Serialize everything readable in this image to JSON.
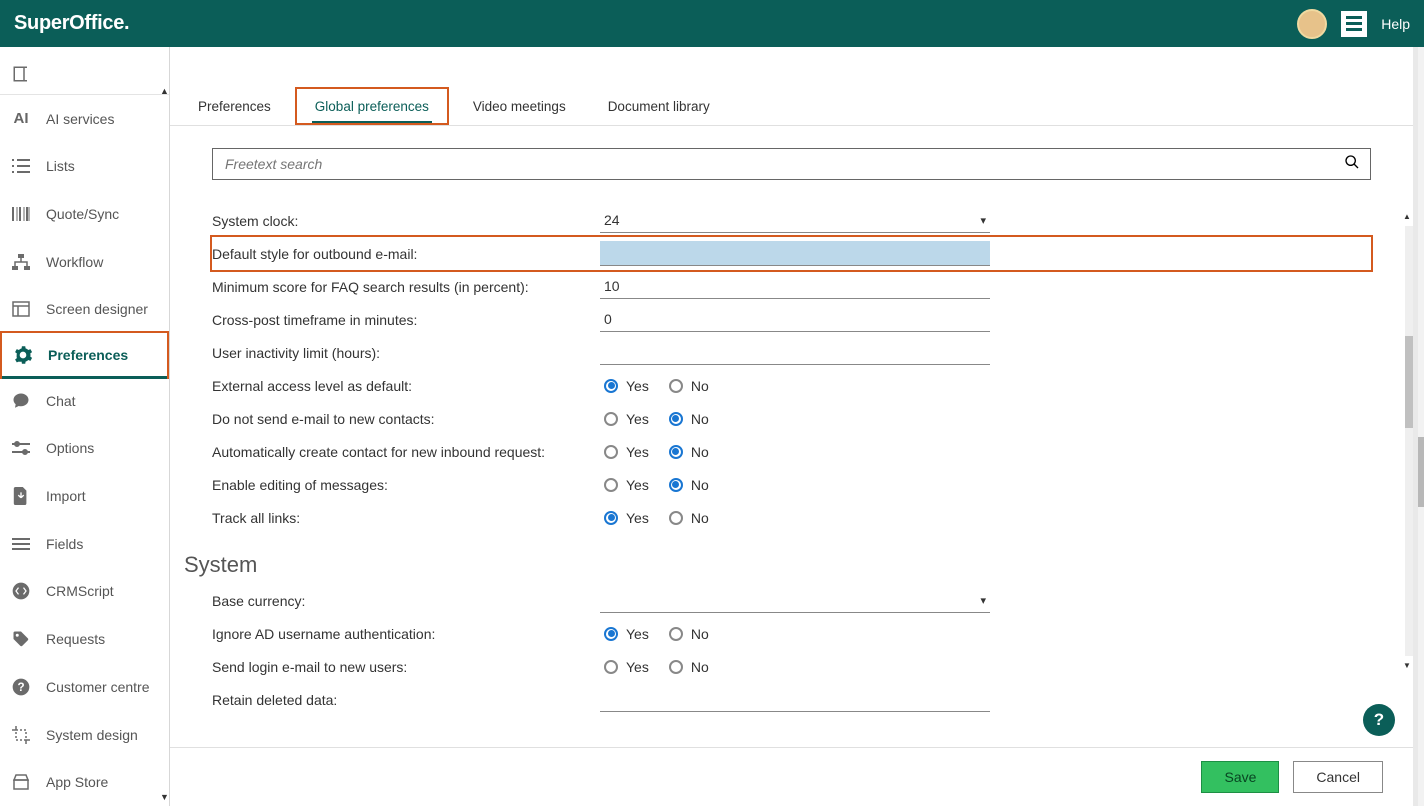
{
  "header": {
    "brand": "SuperOffice.",
    "help_label": "Help"
  },
  "sidebar": {
    "items": [
      {
        "label": ""
      },
      {
        "label": "AI services"
      },
      {
        "label": "Lists"
      },
      {
        "label": "Quote/Sync"
      },
      {
        "label": "Workflow"
      },
      {
        "label": "Screen designer"
      },
      {
        "label": "Preferences"
      },
      {
        "label": "Chat"
      },
      {
        "label": "Options"
      },
      {
        "label": "Import"
      },
      {
        "label": "Fields"
      },
      {
        "label": "CRMScript"
      },
      {
        "label": "Requests"
      },
      {
        "label": "Customer centre"
      },
      {
        "label": "System design"
      },
      {
        "label": "App Store"
      }
    ]
  },
  "tabs": {
    "items": [
      {
        "label": "Preferences"
      },
      {
        "label": "Global preferences"
      },
      {
        "label": "Video meetings"
      },
      {
        "label": "Document library"
      }
    ]
  },
  "search": {
    "placeholder": "Freetext search"
  },
  "form": {
    "yes": "Yes",
    "no": "No",
    "rows": {
      "system_clock": {
        "label": "System clock:",
        "value": "24"
      },
      "default_style": {
        "label": "Default style for outbound e-mail:",
        "value": ""
      },
      "min_score": {
        "label": "Minimum score for FAQ search results (in percent):",
        "value": "10"
      },
      "crosspost": {
        "label": "Cross-post timeframe in minutes:",
        "value": "0"
      },
      "inactivity": {
        "label": "User inactivity limit (hours):",
        "value": ""
      },
      "external_access": {
        "label": "External access level as default:",
        "selected": "yes"
      },
      "do_not_send": {
        "label": "Do not send e-mail to new contacts:",
        "selected": "no"
      },
      "auto_create": {
        "label": "Automatically create contact for new inbound request:",
        "selected": "no"
      },
      "enable_edit": {
        "label": "Enable editing of messages:",
        "selected": "no"
      },
      "track_links": {
        "label": "Track all links:",
        "selected": "yes"
      },
      "base_currency": {
        "label": "Base currency:",
        "value": ""
      },
      "ignore_ad": {
        "label": "Ignore AD username authentication:",
        "selected": "yes"
      },
      "send_login": {
        "label": "Send login e-mail to new users:",
        "selected": ""
      },
      "retain": {
        "label": "Retain deleted data:",
        "value": ""
      }
    },
    "section_system": "System"
  },
  "footer": {
    "save": "Save",
    "cancel": "Cancel"
  }
}
